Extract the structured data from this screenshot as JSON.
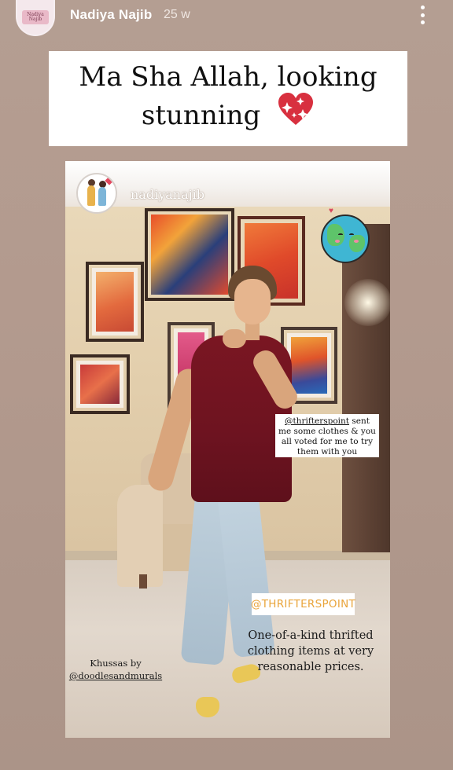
{
  "story": {
    "username": "Nadiya Najib",
    "time_ago": "25 w",
    "avatar_text": "Nadiya Najib"
  },
  "caption": {
    "line1": "Ma Sha Allah, looking",
    "line2": "stunning"
  },
  "post": {
    "username": "nadiyanajib",
    "note_mention": "@thrifterspoint",
    "note_text": " sent me some clothes & you all voted for me to try them with you",
    "brand_tag": "@THRIFTERSPOINT",
    "tagline": "One-of-a-kind thrifted clothing items at very reasonable prices.",
    "credit_prefix": "Khussas by",
    "credit_mention": "@doodlesandmurals"
  },
  "colors": {
    "background": "#b49e92",
    "brand_tag_text": "#e9a43a",
    "heart": "#d8303f"
  },
  "icons": [
    "more-options-icon",
    "sparkle-heart-icon",
    "globe-sticker-icon"
  ]
}
